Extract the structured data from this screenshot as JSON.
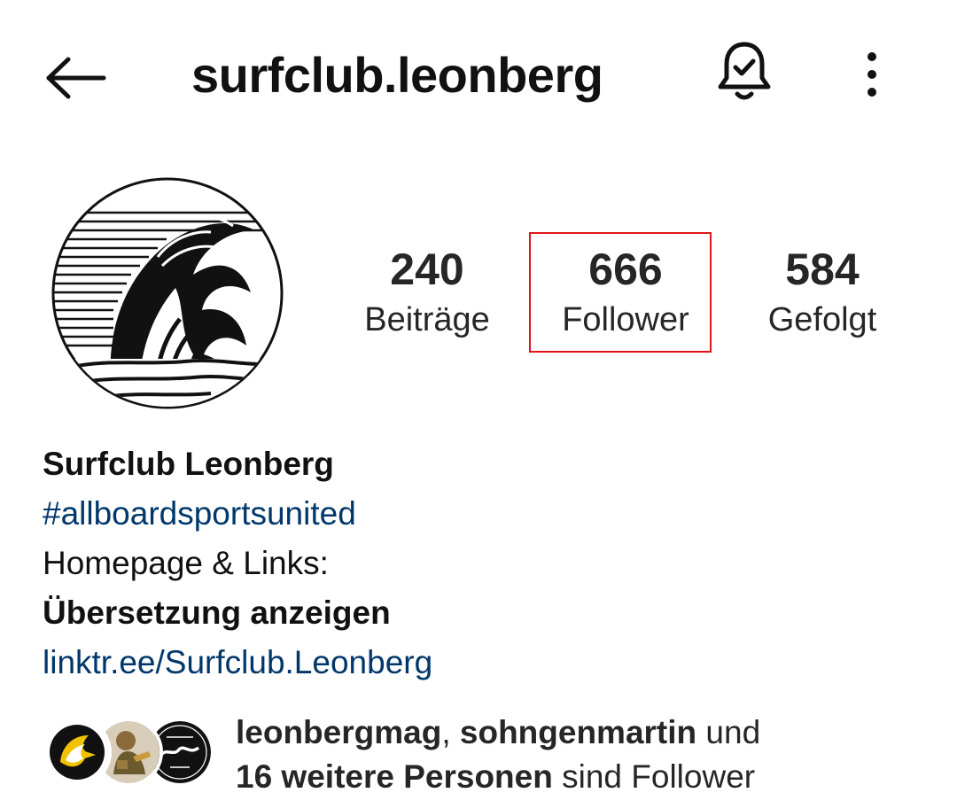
{
  "header": {
    "username": "surfclub.leonberg",
    "back_icon": "arrow-left-icon",
    "bell_icon": "bell-check-icon",
    "more_icon": "vertical-dots-icon"
  },
  "stats": {
    "posts": {
      "value": "240",
      "label": "Beiträge"
    },
    "followers": {
      "value": "666",
      "label": "Follower"
    },
    "following": {
      "value": "584",
      "label": "Gefolgt"
    }
  },
  "bio": {
    "name": "Surfclub Leonberg",
    "hashtag": "#allboardsportsunited",
    "text": "Homepage & Links:",
    "translate": "Übersetzung anzeigen",
    "link": "linktr.ee/Surfclub.Leonberg"
  },
  "followed_by": {
    "user1": "leonbergmag",
    "sep": ", ",
    "user2": "sohngenmartin",
    "and": " und",
    "others": "16 weitere Personen",
    "suffix": " sind Follower"
  },
  "colors": {
    "link": "#00376b",
    "highlight": "#e0151b",
    "text": "#262626"
  }
}
